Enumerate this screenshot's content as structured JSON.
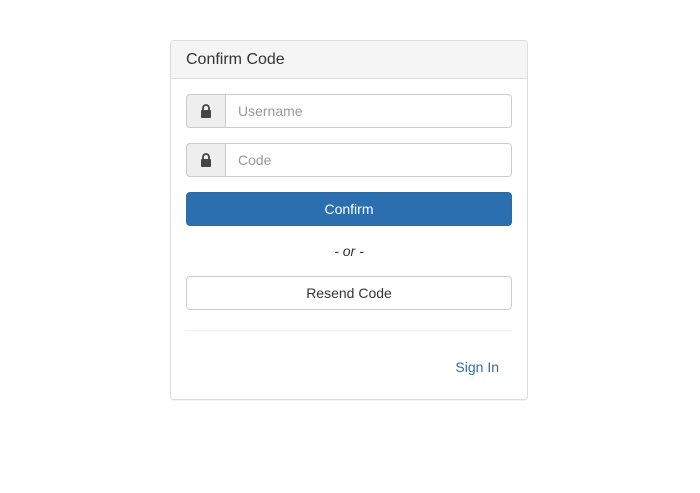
{
  "panel": {
    "title": "Confirm Code"
  },
  "form": {
    "username": {
      "placeholder": "Username",
      "value": "",
      "icon": "lock-icon"
    },
    "code": {
      "placeholder": "Code",
      "value": "",
      "icon": "lock-icon"
    },
    "confirm_label": "Confirm",
    "or_text": "- or -",
    "resend_label": "Resend Code",
    "signin_label": "Sign In"
  },
  "colors": {
    "primary": "#2b6fb0",
    "link": "#2a6db0",
    "heading_bg": "#f5f5f5",
    "addon_bg": "#eeeeee"
  }
}
